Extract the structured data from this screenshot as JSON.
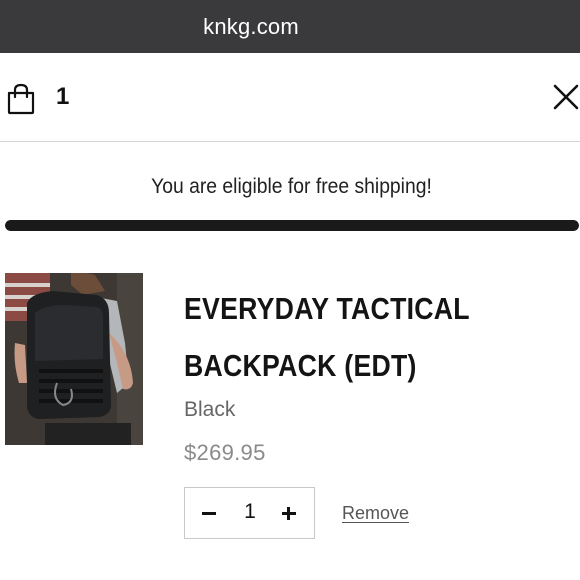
{
  "browser": {
    "url": "knkg.com"
  },
  "cart": {
    "count": "1",
    "icons": {
      "bag": "shopping-bag-icon",
      "close": "close-icon"
    }
  },
  "shipping": {
    "message": "You are eligible for free shipping!",
    "progress": 1.0
  },
  "item": {
    "title_line1": "EVERYDAY TACTICAL",
    "title_line2": "BACKPACK (EDT)",
    "variant": "Black",
    "price": "$269.95",
    "quantity": "1",
    "remove_label": "Remove"
  },
  "colors": {
    "urlbar_bg": "#3a3a3c",
    "progress_fill": "#1a1a1a",
    "price": "#8a8a8a"
  }
}
